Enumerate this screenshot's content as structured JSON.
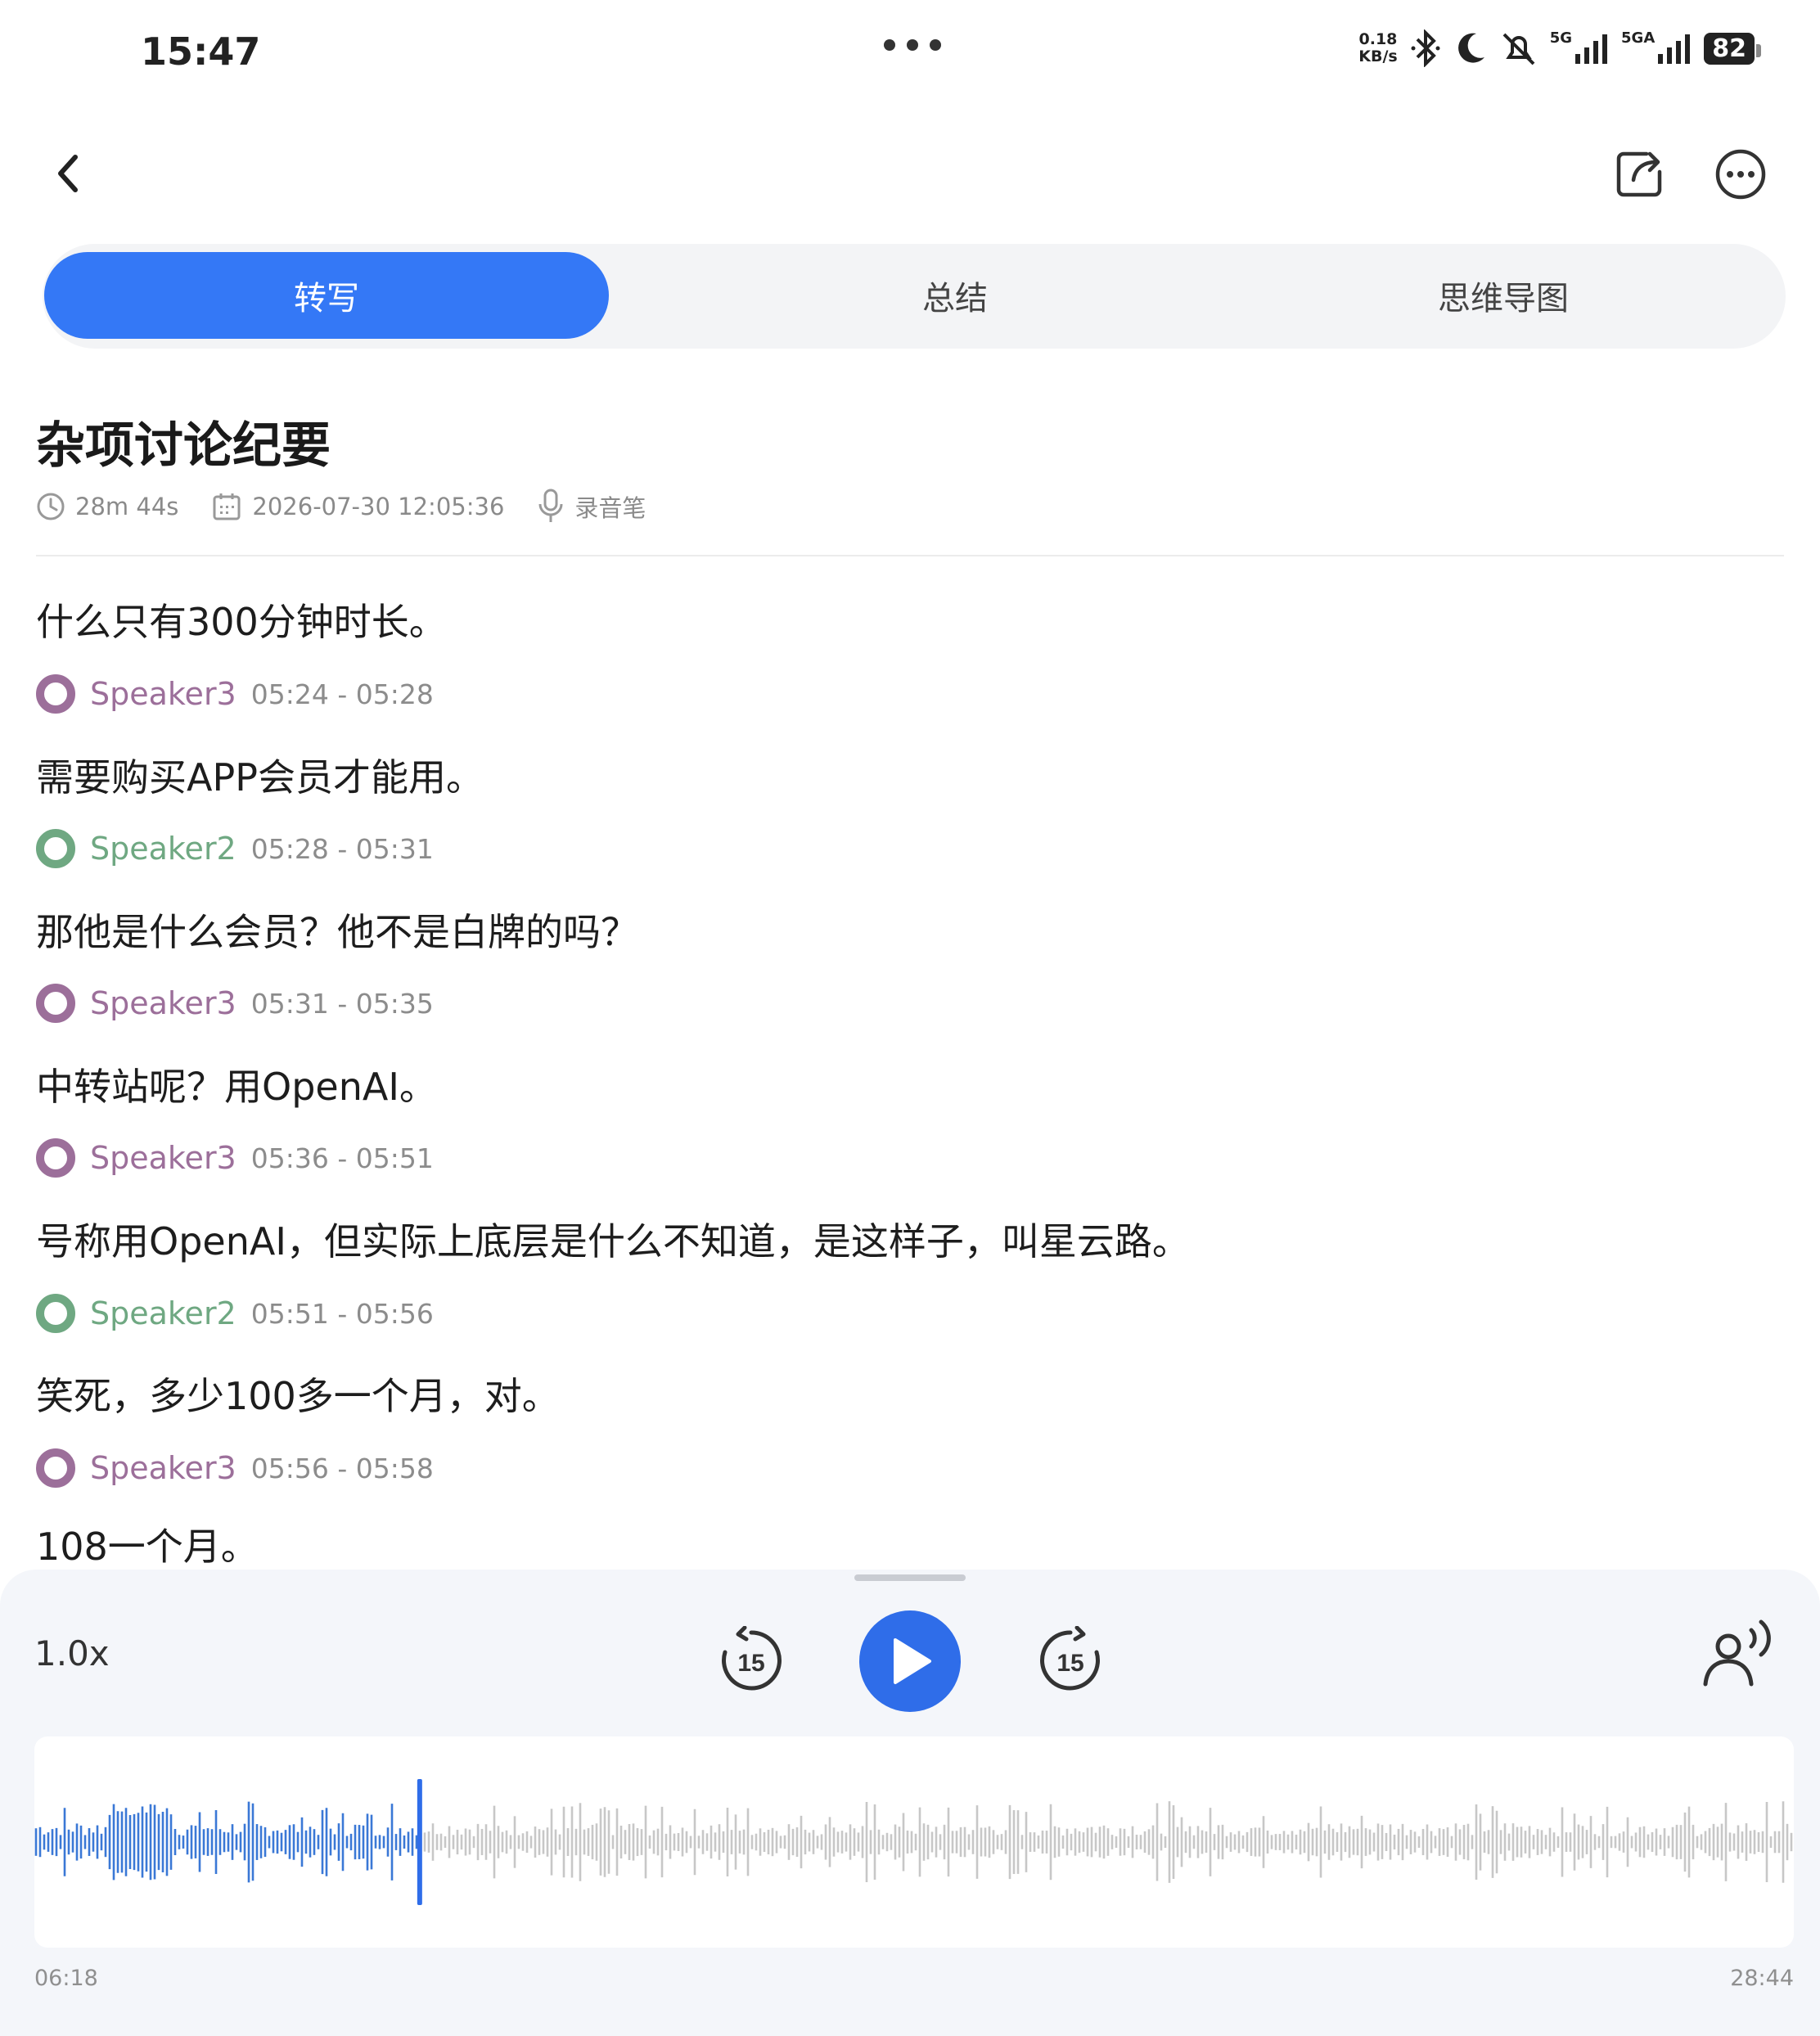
{
  "status_bar": {
    "time": "15:47",
    "net_speed_value": "0.18",
    "net_speed_unit": "KB/s",
    "signal1_label": "5G",
    "signal2_label": "5GA",
    "battery": "82",
    "icons": [
      "bluetooth-icon",
      "moon-icon",
      "bell-muted-icon",
      "signal-icon",
      "signal-icon",
      "battery-icon"
    ]
  },
  "tabs": [
    {
      "label": "转写",
      "active": true
    },
    {
      "label": "总结",
      "active": false
    },
    {
      "label": "思维导图",
      "active": false
    }
  ],
  "recording": {
    "title": "杂项讨论纪要",
    "duration": "28m 44s",
    "datetime": "2026-07-30 12:05:36",
    "source": "录音笔"
  },
  "colors": {
    "accent": "#3478f6",
    "speaker2": "#6fa882",
    "speaker3": "#9c6f9a",
    "played_wave": "#3a78d6",
    "unplayed_wave": "#c7c7c7"
  },
  "transcript": [
    {
      "type": "text",
      "text": "什么只有300分钟时长。"
    },
    {
      "type": "speaker",
      "name": "Speaker3",
      "time": "05:24 - 05:28",
      "color": "#9c6f9a"
    },
    {
      "type": "text",
      "text": "需要购买APP会员才能用。"
    },
    {
      "type": "speaker",
      "name": "Speaker2",
      "time": "05:28 - 05:31",
      "color": "#6fa882"
    },
    {
      "type": "text",
      "text": "那他是什么会员？他不是白牌的吗？"
    },
    {
      "type": "speaker",
      "name": "Speaker3",
      "time": "05:31 - 05:35",
      "color": "#9c6f9a"
    },
    {
      "type": "text",
      "text": "中转站呢？用OpenAI。"
    },
    {
      "type": "speaker",
      "name": "Speaker3",
      "time": "05:36 - 05:51",
      "color": "#9c6f9a"
    },
    {
      "type": "text",
      "text": "号称用OpenAI，但实际上底层是什么不知道，是这样子，叫星云路。"
    },
    {
      "type": "speaker",
      "name": "Speaker2",
      "time": "05:51 - 05:56",
      "color": "#6fa882"
    },
    {
      "type": "text",
      "text": "笑死，多少100多一个月，对。"
    },
    {
      "type": "speaker",
      "name": "Speaker3",
      "time": "05:56 - 05:58",
      "color": "#9c6f9a"
    },
    {
      "type": "text",
      "text": "108一个月。"
    }
  ],
  "player": {
    "speed": "1.0x",
    "skip_back": "15",
    "skip_forward": "15",
    "current_time": "06:18",
    "total_time": "28:44",
    "progress": 0.219
  }
}
